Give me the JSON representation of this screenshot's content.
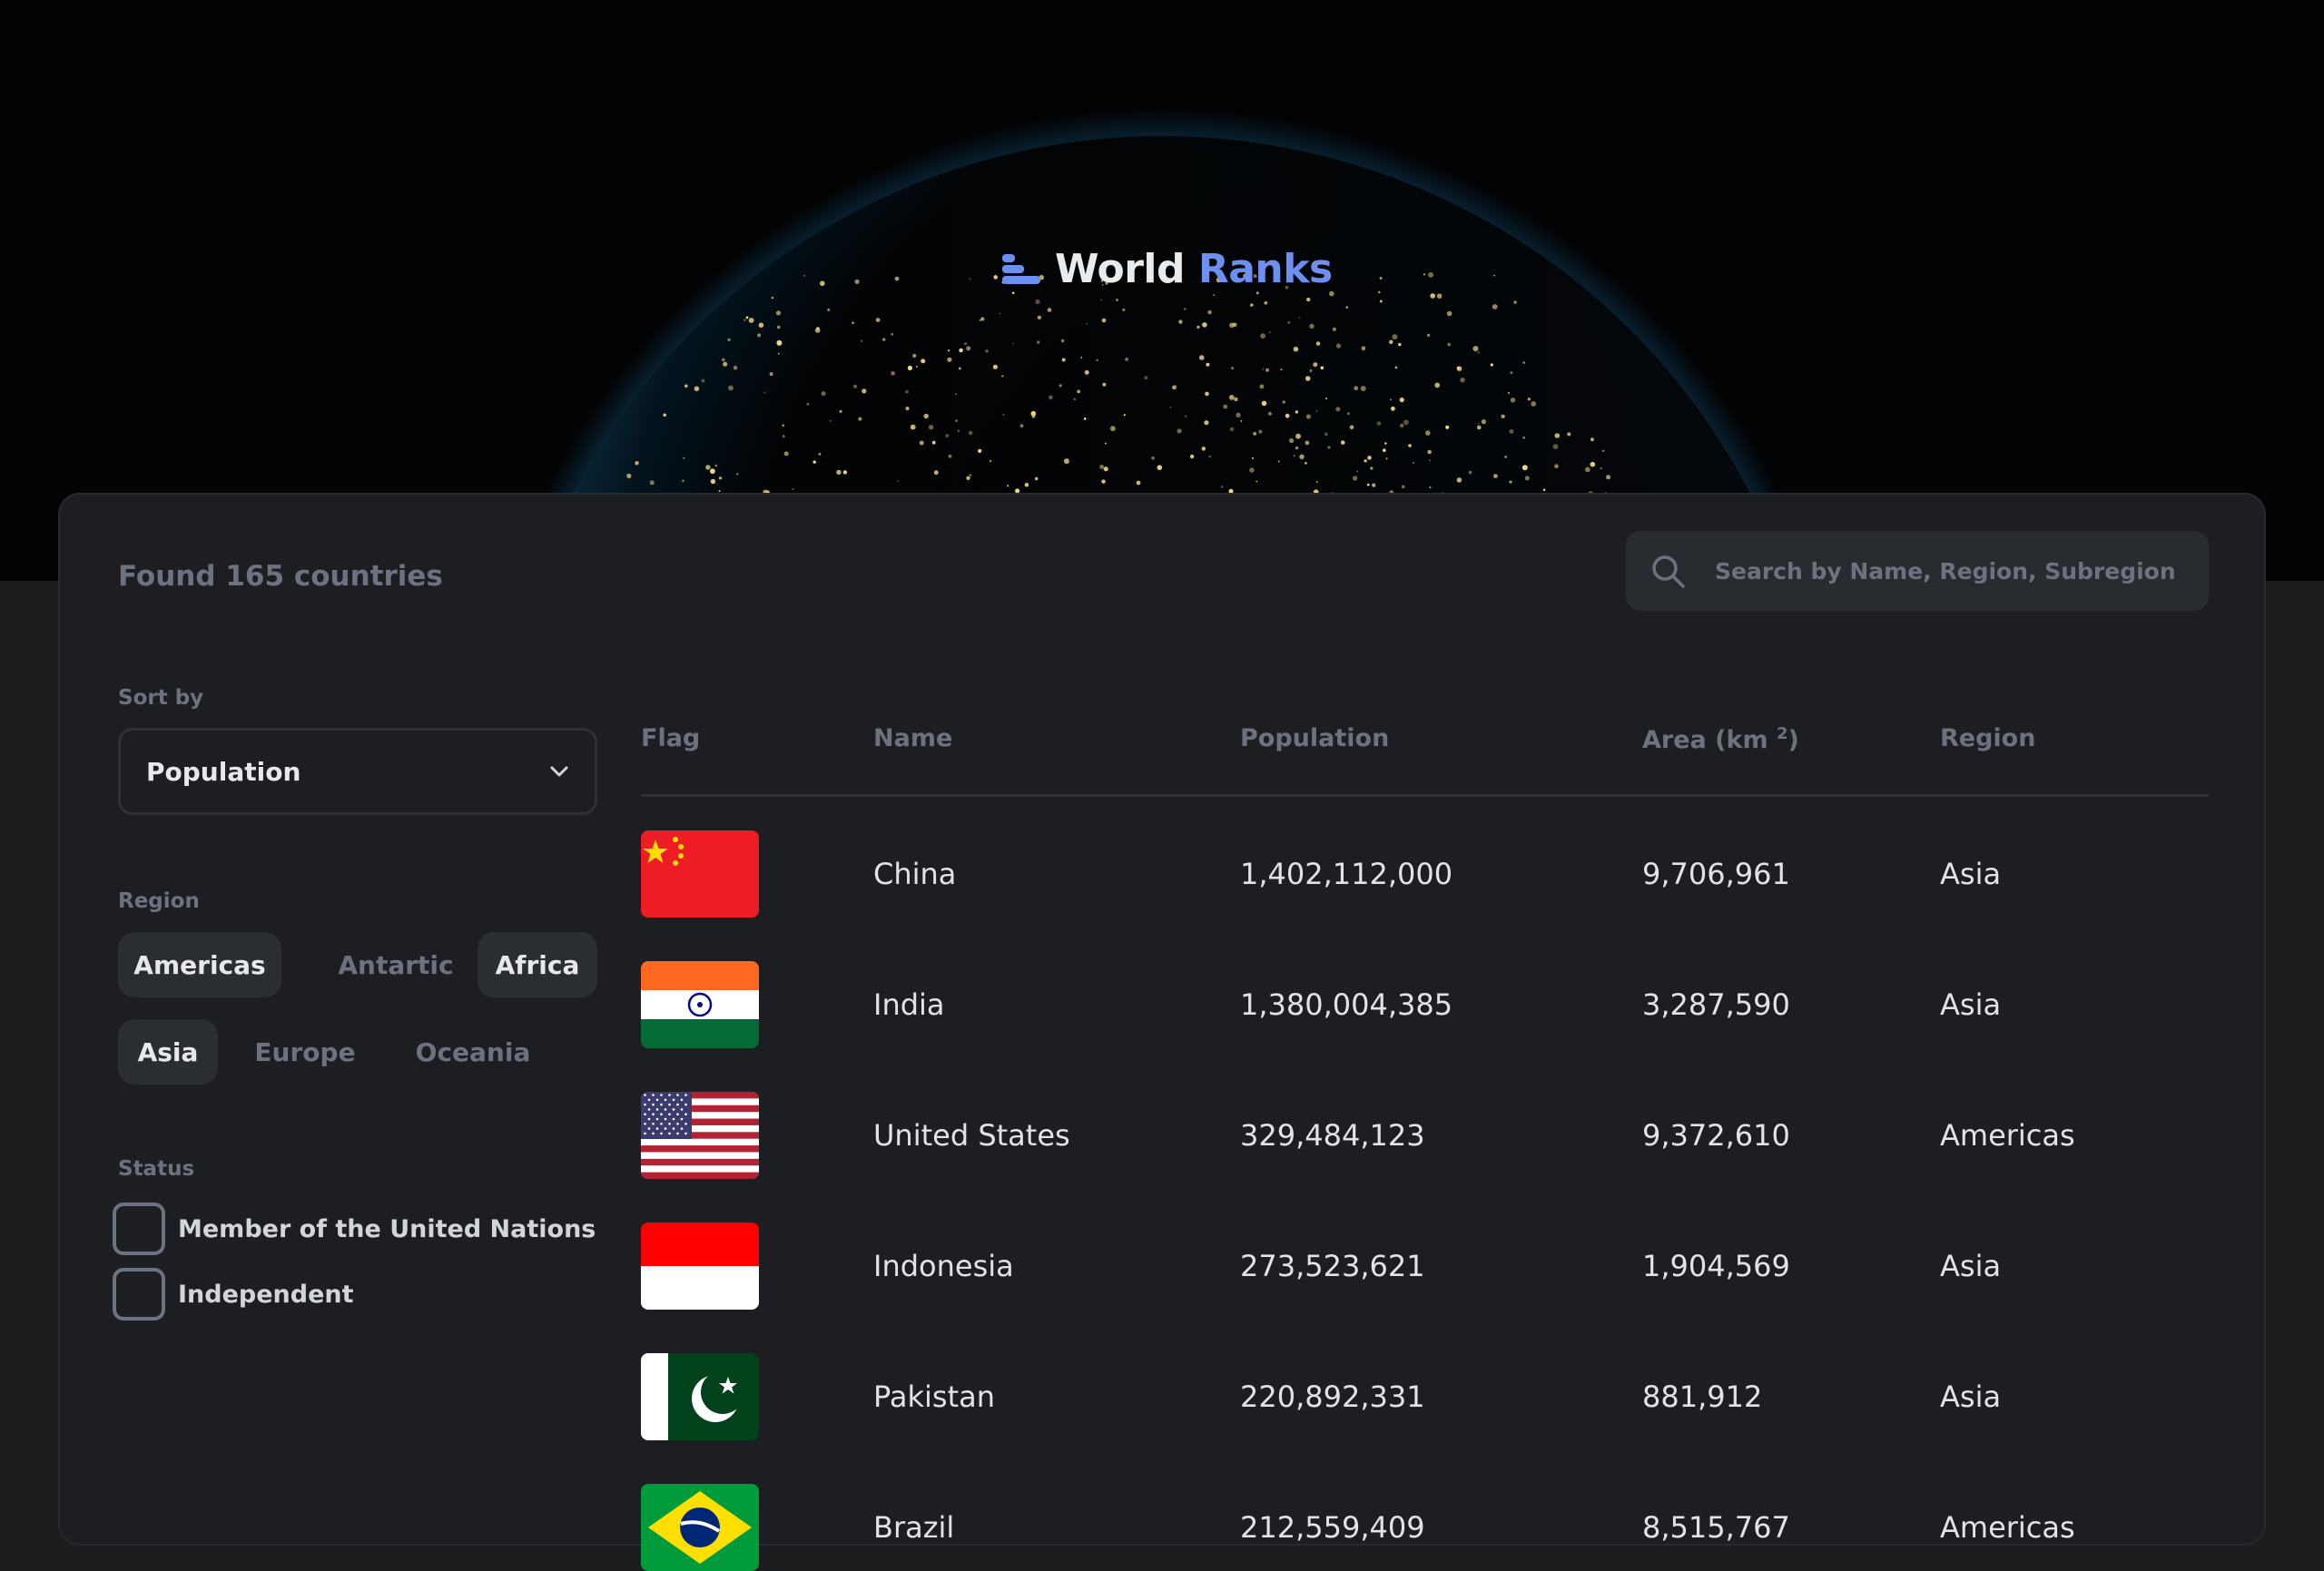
{
  "app": {
    "logo_part1": "World",
    "logo_part2": "Ranks"
  },
  "summary": {
    "found_text": "Found 165 countries"
  },
  "search": {
    "placeholder": "Search by Name, Region, Subregion"
  },
  "filters": {
    "sort_label": "Sort by",
    "sort_value": "Population",
    "region_label": "Region",
    "regions": [
      {
        "label": "Americas",
        "active": true
      },
      {
        "label": "Antartic",
        "active": false
      },
      {
        "label": "Africa",
        "active": true
      },
      {
        "label": "Asia",
        "active": true
      },
      {
        "label": "Europe",
        "active": false
      },
      {
        "label": "Oceania",
        "active": false
      }
    ],
    "status_label": "Status",
    "status_options": [
      {
        "label": "Member of the United Nations",
        "checked": false
      },
      {
        "label": "Independent",
        "checked": false
      }
    ]
  },
  "table": {
    "headers": {
      "flag": "Flag",
      "name": "Name",
      "population": "Population",
      "area": "Area (km ",
      "area_sup": "2",
      "area_close": ")",
      "region": "Region"
    },
    "rows": [
      {
        "flag": "china-flag",
        "name": "China",
        "population": "1,402,112,000",
        "area": "9,706,961",
        "region": "Asia"
      },
      {
        "flag": "india-flag",
        "name": "India",
        "population": "1,380,004,385",
        "area": "3,287,590",
        "region": "Asia"
      },
      {
        "flag": "united-states-flag",
        "name": "United States",
        "population": "329,484,123",
        "area": "9,372,610",
        "region": "Americas"
      },
      {
        "flag": "indonesia-flag",
        "name": "Indonesia",
        "population": "273,523,621",
        "area": "1,904,569",
        "region": "Asia"
      },
      {
        "flag": "pakistan-flag",
        "name": "Pakistan",
        "population": "220,892,331",
        "area": "881,912",
        "region": "Asia"
      },
      {
        "flag": "brazil-flag",
        "name": "Brazil",
        "population": "212,559,409",
        "area": "8,515,767",
        "region": "Americas"
      }
    ]
  },
  "colors": {
    "page_bg": "#1b1d1f",
    "card_bg": "#1c1e21",
    "accent_blue": "#6d8ff0",
    "muted_text": "#6c727f",
    "chip_active_bg": "#2a2d32"
  }
}
